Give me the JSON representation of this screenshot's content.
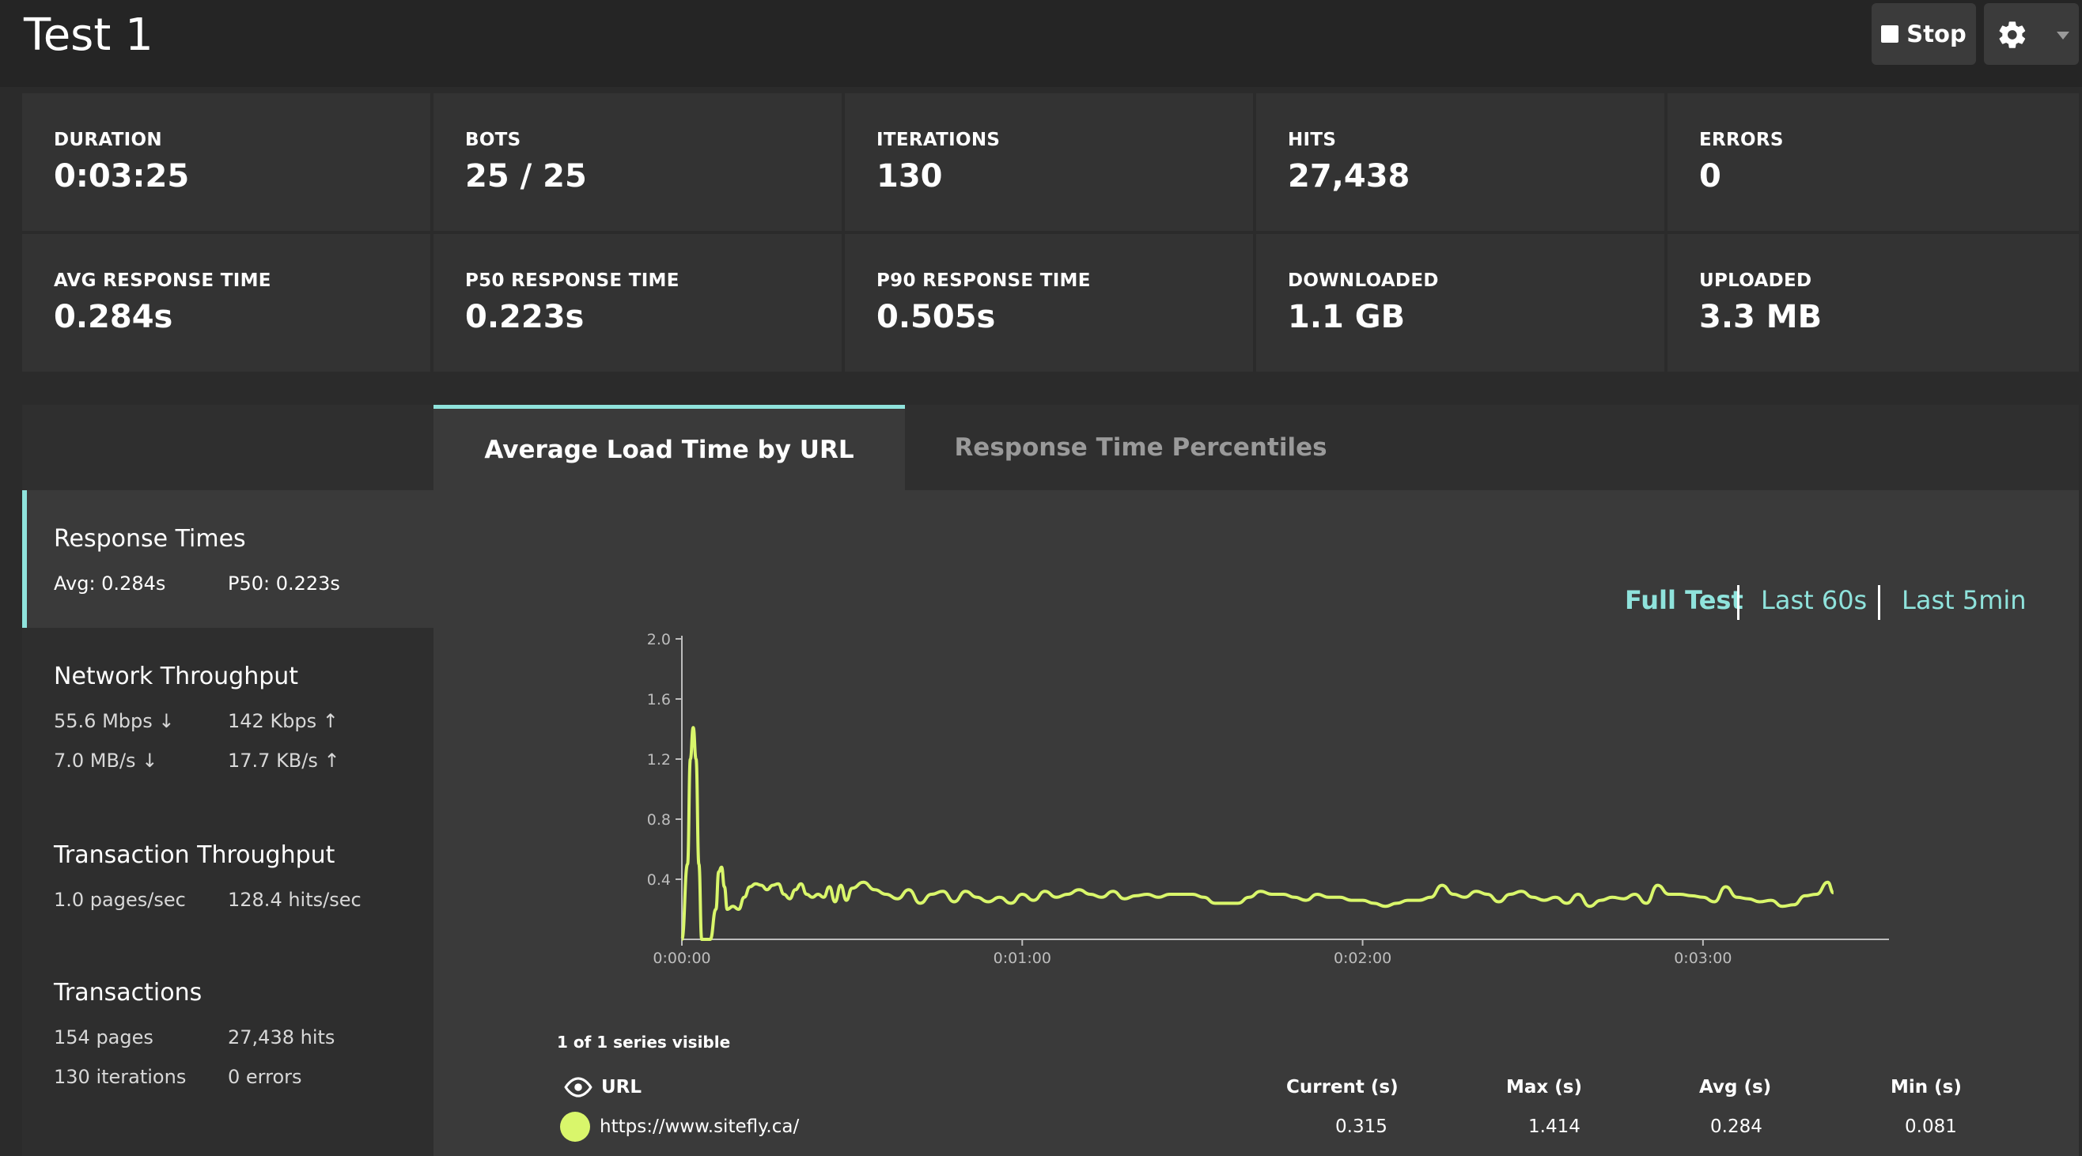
{
  "header": {
    "title": "Test 1",
    "stop_label": "Stop",
    "settings_icon": "gear-icon",
    "settings_caret_icon": "chevron-down-icon"
  },
  "stats": [
    {
      "label": "DURATION",
      "value": "0:03:25"
    },
    {
      "label": "BOTS",
      "value": "25 / 25"
    },
    {
      "label": "ITERATIONS",
      "value": "130"
    },
    {
      "label": "HITS",
      "value": "27,438"
    },
    {
      "label": "ERRORS",
      "value": "0"
    },
    {
      "label": "AVG RESPONSE TIME",
      "value": "0.284s"
    },
    {
      "label": "P50 RESPONSE TIME",
      "value": "0.223s"
    },
    {
      "label": "P90 RESPONSE TIME",
      "value": "0.505s"
    },
    {
      "label": "DOWNLOADED",
      "value": "1.1 GB"
    },
    {
      "label": "UPLOADED",
      "value": "3.3 MB"
    }
  ],
  "tabs": [
    {
      "label": "Average Load Time by URL",
      "active": true
    },
    {
      "label": "Response Time Percentiles",
      "active": false
    }
  ],
  "sidebar": {
    "response_times": {
      "title": "Response Times",
      "avg": "Avg: 0.284s",
      "p50": "P50: 0.223s"
    },
    "network": {
      "title": "Network Throughput",
      "down_mbps": "55.6 Mbps",
      "up_kbps": "142 Kbps",
      "down_mbs": "7.0 MB/s",
      "up_kbs": "17.7 KB/s"
    },
    "transaction_throughput": {
      "title": "Transaction Throughput",
      "pages": "1.0 pages/sec",
      "hits": "128.4 hits/sec"
    },
    "transactions": {
      "title": "Transactions",
      "pages": "154 pages",
      "hits": "27,438 hits",
      "iterations": "130 iterations",
      "errors": "0 errors"
    }
  },
  "range_selector": {
    "full": "Full Test",
    "last60": "Last 60s",
    "last5": "Last 5min"
  },
  "chart_data": {
    "type": "line",
    "x_ticks": [
      "0:00:00",
      "0:01:00",
      "0:02:00",
      "0:03:00"
    ],
    "y_ticks": [
      "0.4",
      "0.8",
      "1.2",
      "1.6",
      "2.0"
    ],
    "xlim_seconds": [
      0,
      203
    ],
    "ylim": [
      0,
      2.0
    ],
    "series": [
      {
        "color": "#d9f66b",
        "x": [
          0,
          1,
          1.5,
          2,
          2.5,
          3,
          3.5,
          4,
          5,
          6,
          6.5,
          7,
          7.5,
          8,
          9,
          10,
          11,
          12,
          13,
          14,
          15,
          16,
          17,
          18,
          19,
          20,
          21,
          22,
          23,
          24,
          25,
          26,
          27,
          28,
          29,
          30,
          32,
          34,
          36,
          38,
          40,
          42,
          44,
          46,
          48,
          50,
          52,
          54,
          56,
          58,
          60,
          62,
          64,
          66,
          68,
          70,
          72,
          74,
          76,
          78,
          80,
          82,
          84,
          86,
          88,
          90,
          92,
          94,
          96,
          98,
          100,
          102,
          104,
          106,
          108,
          110,
          112,
          114,
          116,
          118,
          120,
          122,
          124,
          126,
          128,
          130,
          132,
          134,
          136,
          138,
          140,
          142,
          144,
          146,
          148,
          150,
          152,
          154,
          156,
          158,
          160,
          162,
          164,
          166,
          168,
          170,
          172,
          174,
          176,
          178,
          180,
          182,
          184,
          186,
          188,
          190,
          192,
          194,
          196,
          198,
          200,
          202,
          203
        ],
        "values": [
          0,
          0.5,
          1.2,
          1.41,
          1.2,
          0.5,
          0,
          0,
          0,
          0.2,
          0.45,
          0.48,
          0.35,
          0.2,
          0.22,
          0.2,
          0.28,
          0.35,
          0.37,
          0.36,
          0.33,
          0.36,
          0.37,
          0.3,
          0.27,
          0.33,
          0.37,
          0.3,
          0.28,
          0.3,
          0.28,
          0.35,
          0.25,
          0.36,
          0.26,
          0.34,
          0.38,
          0.33,
          0.3,
          0.27,
          0.33,
          0.24,
          0.3,
          0.32,
          0.25,
          0.32,
          0.28,
          0.25,
          0.28,
          0.24,
          0.3,
          0.26,
          0.32,
          0.28,
          0.3,
          0.33,
          0.3,
          0.28,
          0.32,
          0.27,
          0.29,
          0.3,
          0.28,
          0.3,
          0.3,
          0.3,
          0.28,
          0.24,
          0.24,
          0.24,
          0.28,
          0.32,
          0.3,
          0.3,
          0.28,
          0.26,
          0.3,
          0.28,
          0.28,
          0.26,
          0.26,
          0.24,
          0.22,
          0.24,
          0.26,
          0.26,
          0.28,
          0.36,
          0.3,
          0.28,
          0.32,
          0.3,
          0.25,
          0.3,
          0.32,
          0.28,
          0.26,
          0.28,
          0.24,
          0.3,
          0.22,
          0.26,
          0.28,
          0.27,
          0.3,
          0.24,
          0.36,
          0.3,
          0.3,
          0.29,
          0.28,
          0.25,
          0.35,
          0.28,
          0.27,
          0.25,
          0.26,
          0.22,
          0.23,
          0.29,
          0.3,
          0.38,
          0.31
        ]
      }
    ]
  },
  "series_visible_text": "1 of 1 series visible",
  "table": {
    "headers": {
      "url": "URL",
      "current": "Current (s)",
      "max": "Max (s)",
      "avg": "Avg (s)",
      "min": "Min (s)"
    },
    "rows": [
      {
        "url": "https://www.sitefly.ca/",
        "current": "0.315",
        "max": "1.414",
        "avg": "0.284",
        "min": "0.081"
      }
    ]
  }
}
